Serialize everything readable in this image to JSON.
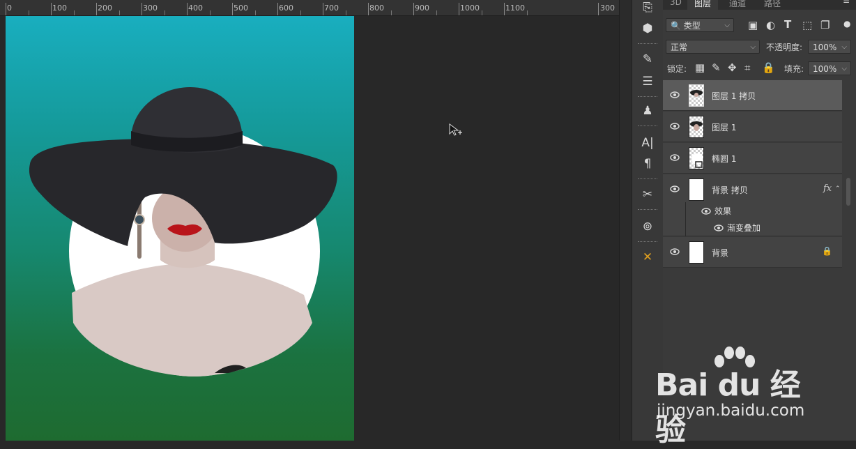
{
  "ruler": {
    "labels": [
      "0",
      "100",
      "200",
      "300",
      "400",
      "500",
      "600",
      "700",
      "800",
      "900",
      "1000",
      "1100",
      "300"
    ]
  },
  "panel": {
    "tabs": [
      "3D",
      "图层",
      "通道",
      "路径"
    ],
    "active_tab": "图层",
    "filter_kind": "类型",
    "blend_mode": "正常",
    "opacity_label": "不透明度:",
    "opacity_value": "100%",
    "lock_label": "锁定:",
    "fill_label": "填充:",
    "fill_value": "100%"
  },
  "layers": [
    {
      "name": "图层 1 拷贝",
      "selected": true
    },
    {
      "name": "图层 1",
      "selected": false
    },
    {
      "name": "椭圆 1",
      "selected": false
    },
    {
      "name": "背景 拷贝",
      "selected": false,
      "fx": "fx"
    },
    {
      "effects_label": "效果",
      "effect": "渐变叠加"
    },
    {
      "name": "背景",
      "selected": false,
      "locked": true
    }
  ],
  "watermark": {
    "logo": "Bai du 经验",
    "url": "jingyan.baidu.com"
  },
  "colors": {
    "canvas_top": "#19aebf",
    "canvas_bottom": "#1e6b30",
    "panel_bg": "#3a3a3a",
    "selected_layer": "#5b5b5b"
  }
}
